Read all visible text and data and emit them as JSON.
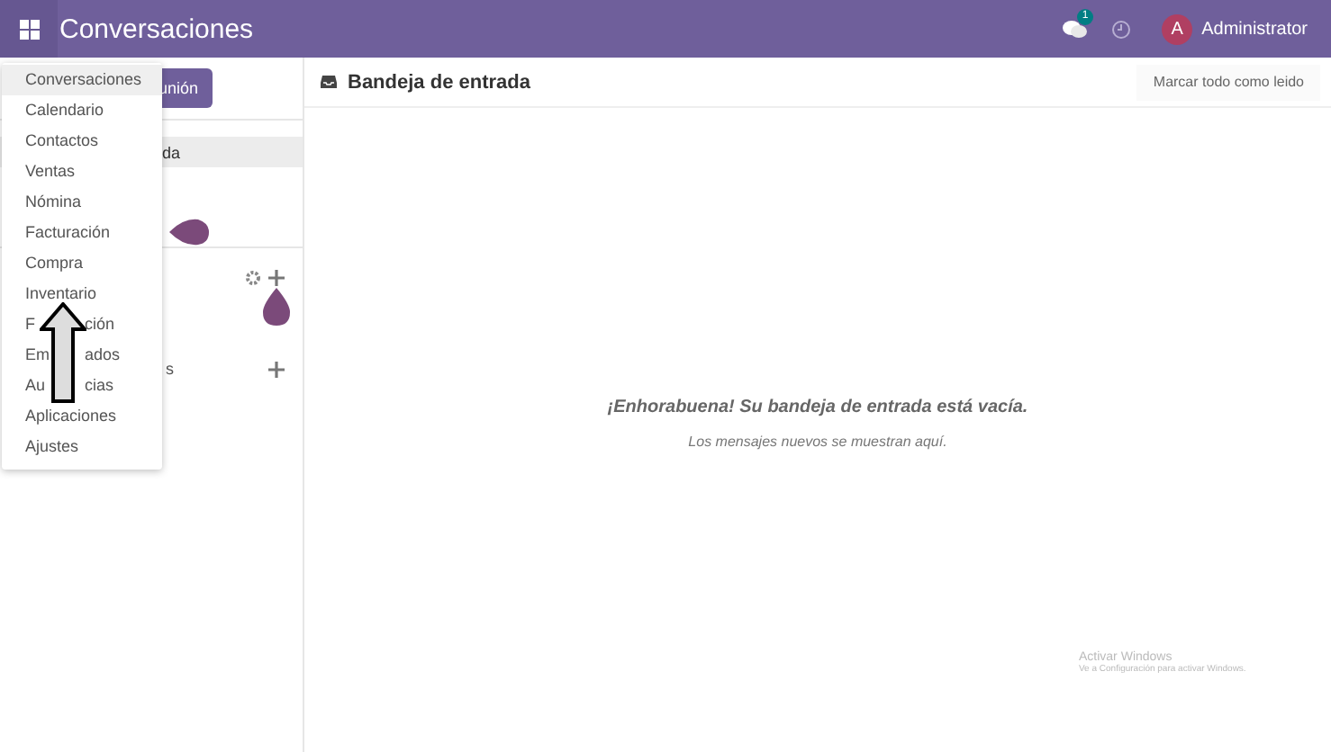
{
  "navbar": {
    "app_title": "Conversaciones",
    "chat_badge": "1",
    "user_initial": "A",
    "user_name": "Administrator"
  },
  "app_menu": {
    "items": [
      {
        "label": "Conversaciones",
        "selected": true
      },
      {
        "label": "Calendario",
        "selected": false
      },
      {
        "label": "Contactos",
        "selected": false
      },
      {
        "label": "Ventas",
        "selected": false
      },
      {
        "label": "Nómina",
        "selected": false
      },
      {
        "label": "Facturación",
        "selected": false
      },
      {
        "label": "Compra",
        "selected": false
      },
      {
        "label": "Inventario",
        "selected": false
      },
      {
        "label": "F",
        "label_end": "ción",
        "selected": false
      },
      {
        "label": "Em",
        "label_end": "ados",
        "selected": false
      },
      {
        "label": "Au",
        "label_end": "cias",
        "selected": false
      },
      {
        "label": "Aplicaciones",
        "selected": false
      },
      {
        "label": "Ajustes",
        "selected": false
      }
    ]
  },
  "sidebar": {
    "button": "unión",
    "inbox_item": "da",
    "section_label": "s"
  },
  "main": {
    "title": "Bandeja de entrada",
    "mark_all_button": "Marcar todo como leido",
    "empty_title": "¡Enhorabuena! Su bandeja de entrada está vacía.",
    "empty_subtitle": "Los mensajes nuevos se muestran aquí."
  },
  "os_notice": {
    "title": "Activar Windows",
    "subtitle": "Ve a Configuración para activar Windows."
  }
}
